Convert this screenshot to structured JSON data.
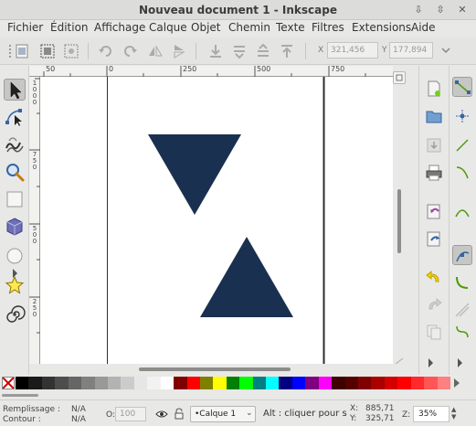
{
  "window": {
    "title": "Nouveau document 1 - Inkscape",
    "buttons": [
      "⇩",
      "⇳",
      "✕"
    ]
  },
  "menu": [
    "Fichier",
    "Édition",
    "Affichage",
    "Calque",
    "Objet",
    "Chemin",
    "Texte",
    "Filtres",
    "Extensions",
    "Aide"
  ],
  "toolbar": {
    "x_label": "X",
    "x_value": "321,456",
    "y_label": "Y",
    "y_value": "177,894"
  },
  "ruler": {
    "h_labels": [
      "50",
      "0",
      "250",
      "500",
      "750"
    ],
    "v_labels": [
      "1000",
      "750",
      "500",
      "250"
    ]
  },
  "canvas": {
    "shape_color": "#1a3050",
    "shapes": [
      "downward-triangle",
      "upward-triangle"
    ]
  },
  "palette": {
    "colors": [
      "#000000",
      "#1a1a1a",
      "#333333",
      "#4d4d4d",
      "#666666",
      "#808080",
      "#999999",
      "#b3b3b3",
      "#cccccc",
      "#e6e6e6",
      "#f2f2f2",
      "#ffffff",
      "#800000",
      "#ff0000",
      "#808000",
      "#ffff00",
      "#008000",
      "#00ff00",
      "#008080",
      "#00ffff",
      "#000080",
      "#0000ff",
      "#800080",
      "#ff00ff",
      "#3f0000",
      "#550000",
      "#800000",
      "#aa0000",
      "#d40000",
      "#ff0000",
      "#ff2a2a",
      "#ff5555",
      "#ff8080"
    ]
  },
  "status": {
    "fill_label": "Remplissage :",
    "fill_value": "N/A",
    "stroke_label": "Contour :",
    "stroke_value": "N/A",
    "opacity_label": "O:",
    "opacity_value": "100",
    "layer": "•Calque 1",
    "message": "Alt : cliquer pour s",
    "x_label": "X:",
    "x_value": "885,71",
    "y_label": "Y:",
    "y_value": "325,71",
    "zoom_label": "Z:",
    "zoom_value": "35%"
  }
}
